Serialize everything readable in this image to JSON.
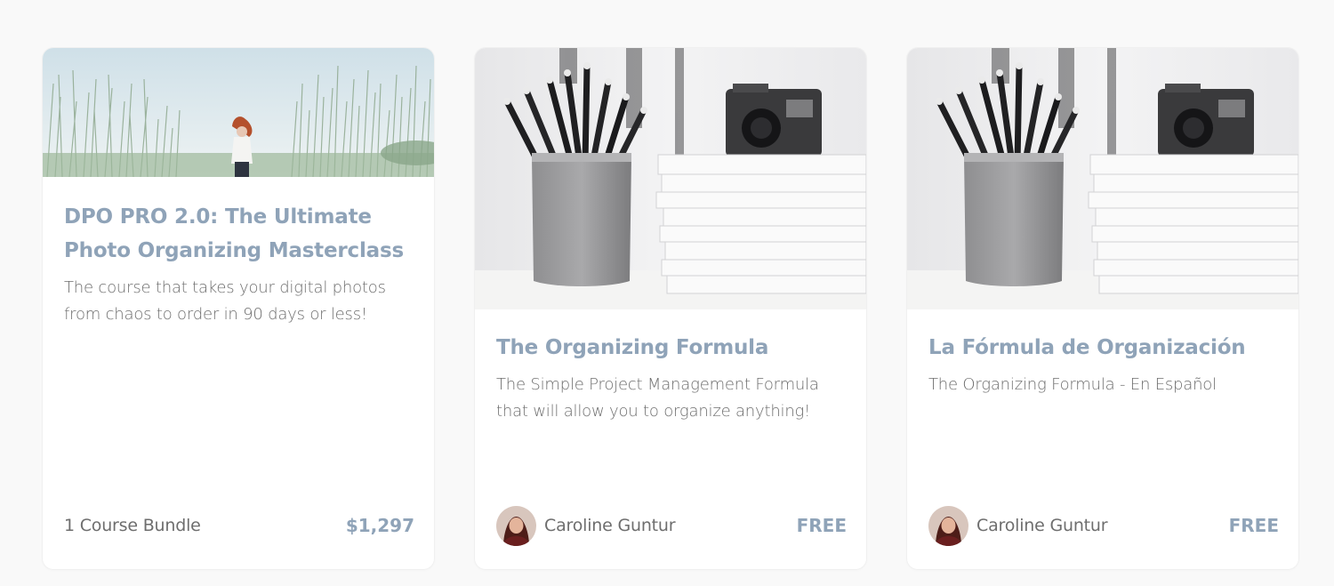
{
  "cards": [
    {
      "image": "woman-in-tall-grass-photo",
      "title": "DPO PRO 2.0: The Ultimate Photo Organizing Masterclass",
      "description": "The course that takes your digital photos from chaos to order in 90 days or less!",
      "meta": "1 Course Bundle",
      "price": "$1,297"
    },
    {
      "image": "pencils-camera-notebooks-photo",
      "title": "The Organizing Formula",
      "description": "The Simple Project Management Formula that will allow you to organize anything!",
      "author": "Caroline Guntur",
      "price": "FREE"
    },
    {
      "image": "pencils-camera-notebooks-photo",
      "title": "La Fórmula de Organización",
      "description": "The Organizing Formula - En Español",
      "author": "Caroline Guntur",
      "price": "FREE"
    }
  ],
  "colors": {
    "title": "#8fa3b8",
    "body_text": "#6e6e6e",
    "card_bg": "#ffffff",
    "page_bg": "#f9f9f9"
  }
}
